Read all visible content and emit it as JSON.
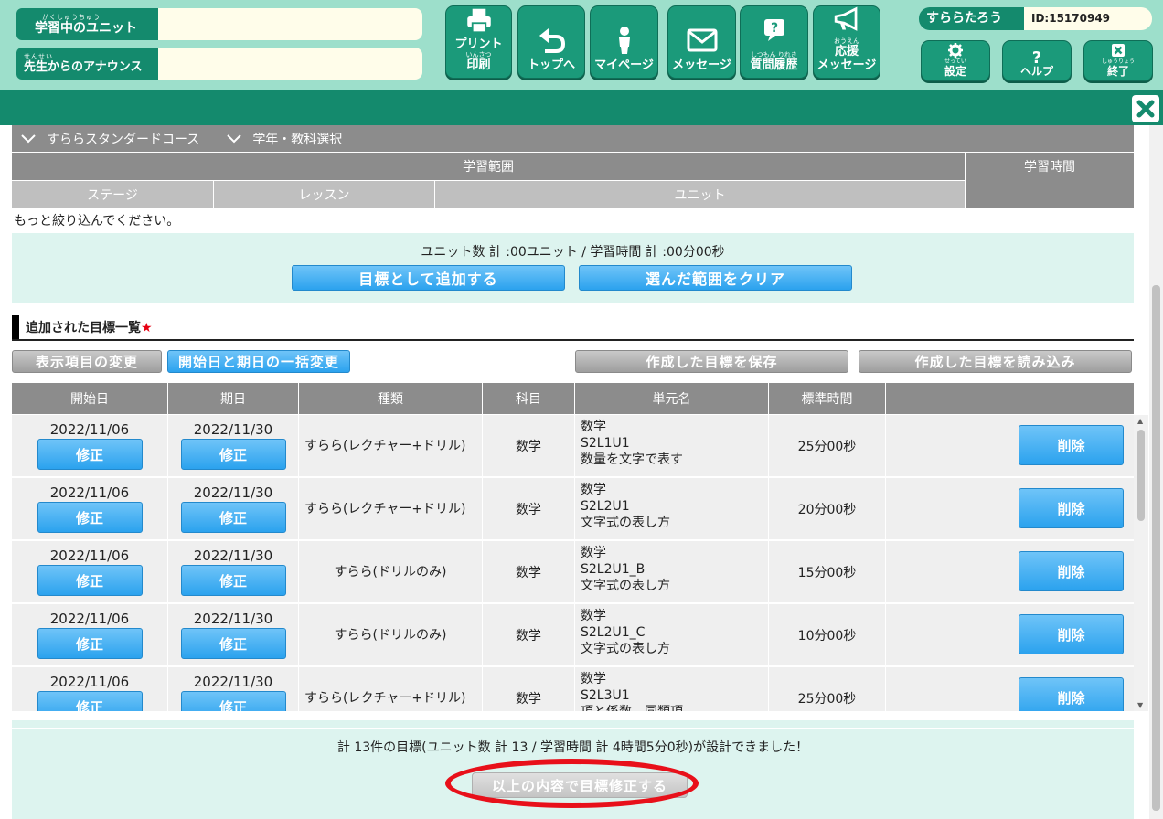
{
  "header": {
    "current_unit": {
      "ruby": "がくしゅうちゅう",
      "label": "学習中のユニット"
    },
    "announce": {
      "ruby": "せんせい",
      "label": "先生からのアナウンス"
    },
    "nav": [
      {
        "ruby": "いんさつ",
        "label1": "プリント",
        "label2": "印刷",
        "icon": "printer-icon"
      },
      {
        "ruby": "",
        "label1": "",
        "label2": "トップへ",
        "icon": "return-arrow-icon"
      },
      {
        "ruby": "",
        "label1": "",
        "label2": "マイページ",
        "icon": "person-icon"
      },
      {
        "ruby": "",
        "label1": "",
        "label2": "メッセージ",
        "icon": "envelope-icon"
      },
      {
        "ruby": "しつもん りれき",
        "label1": "",
        "label2": "質問履歴",
        "icon": "question-bubble-icon"
      },
      {
        "ruby": "おうえん",
        "label1": "応援",
        "label2": "メッセージ",
        "icon": "megaphone-icon"
      }
    ],
    "user_name": "すららたろう",
    "user_id": "ID:15170949",
    "settings": {
      "ruby": "せってい",
      "label": "設定",
      "icon": "gear-icon"
    },
    "help": {
      "ruby": "",
      "label": "ヘルプ",
      "icon": "question-mark-icon"
    },
    "exit": {
      "ruby": "しゅうりょう",
      "label": "終了",
      "icon": "close-box-icon"
    }
  },
  "filters": {
    "course": "すららスタンダードコース",
    "grade": "学年・教科選択"
  },
  "range": {
    "header": "学習範囲",
    "time_header": "学習時間",
    "stage": "ステージ",
    "lesson": "レッスン",
    "unit": "ユニット",
    "message": "もっと絞り込んでください。"
  },
  "summary": {
    "text": "ユニット数 計 :00ユニット / 学習時間 計 :00分00秒",
    "add_button": "目標として追加する",
    "clear_button": "選んだ範囲をクリア"
  },
  "list": {
    "title": "追加された目標一覧",
    "required_mark": "★",
    "change_items_button": "表示項目の変更",
    "bulk_change_button": "開始日と期日の一括変更",
    "save_button": "作成した目標を保存",
    "load_button": "作成した目標を読み込み"
  },
  "table": {
    "columns": [
      "開始日",
      "期日",
      "種類",
      "科目",
      "単元名",
      "標準時間",
      ""
    ],
    "fix_label": "修正",
    "delete_label": "削除",
    "rows": [
      {
        "start": "2022/11/06",
        "due": "2022/11/30",
        "kind": "すらら(レクチャー+ドリル)",
        "subject": "数学",
        "unit1": "数学",
        "unit2": "S2L1U1",
        "unit3": "数量を文字で表す",
        "time": "25分00秒"
      },
      {
        "start": "2022/11/06",
        "due": "2022/11/30",
        "kind": "すらら(レクチャー+ドリル)",
        "subject": "数学",
        "unit1": "数学",
        "unit2": "S2L2U1",
        "unit3": "文字式の表し方",
        "time": "20分00秒"
      },
      {
        "start": "2022/11/06",
        "due": "2022/11/30",
        "kind": "すらら(ドリルのみ)",
        "subject": "数学",
        "unit1": "数学",
        "unit2": "S2L2U1_B",
        "unit3": "文字式の表し方",
        "time": "15分00秒"
      },
      {
        "start": "2022/11/06",
        "due": "2022/11/30",
        "kind": "すらら(ドリルのみ)",
        "subject": "数学",
        "unit1": "数学",
        "unit2": "S2L2U1_C",
        "unit3": "文字式の表し方",
        "time": "10分00秒"
      },
      {
        "start": "2022/11/06",
        "due": "2022/11/30",
        "kind": "すらら(レクチャー+ドリル)",
        "subject": "数学",
        "unit1": "数学",
        "unit2": "S2L3U1",
        "unit3": "項と係数、同類項",
        "time": "25分00秒"
      }
    ]
  },
  "bottom": {
    "text": "計 13件の目標(ユニット数 計 13 / 学習時間 計 4時間5分0秒)が設計できました！",
    "confirm_button": "以上の内容で目標修正する"
  },
  "colors": {
    "header_bg": "#9ddfcb",
    "brand_green": "#148a6d",
    "accent_blue": "#2ba2ee",
    "highlight_red": "#e8101a"
  }
}
